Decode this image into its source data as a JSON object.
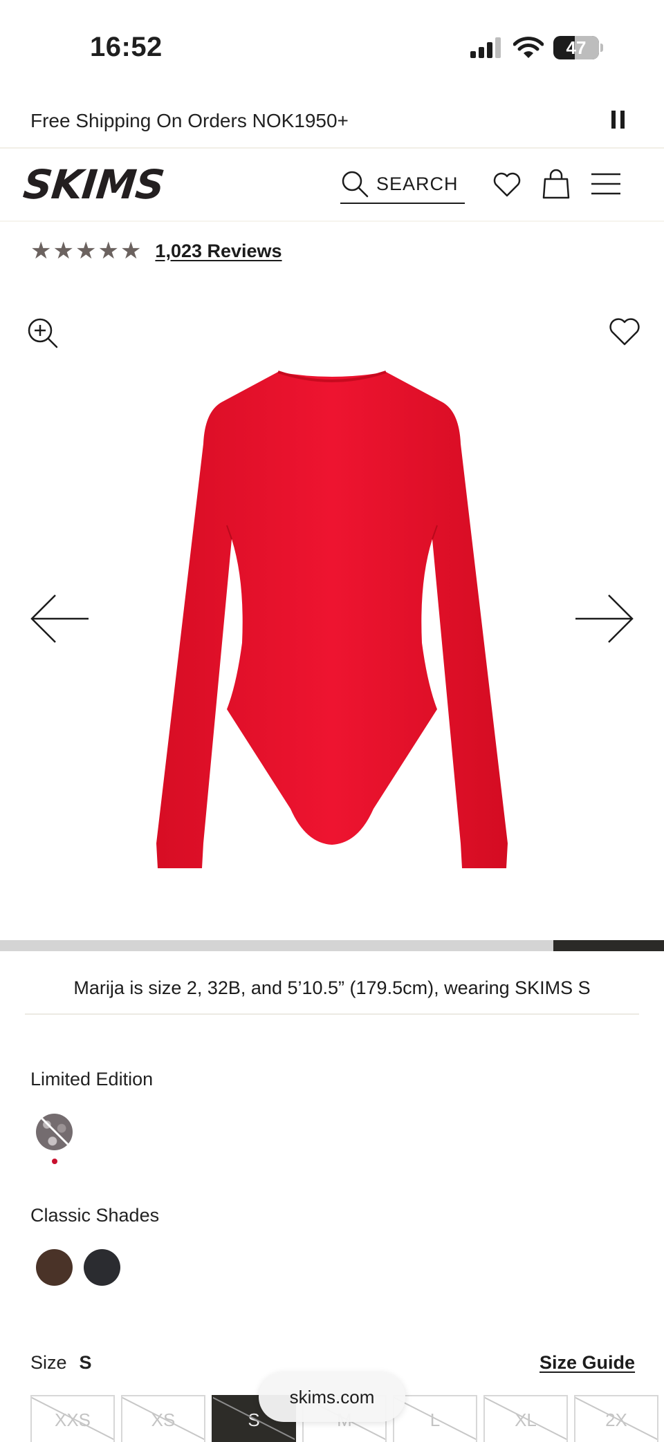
{
  "status": {
    "time": "16:52",
    "battery": "47",
    "battery_level": 0.47,
    "icons": [
      "signal-icon",
      "wifi-icon",
      "battery-icon"
    ]
  },
  "promo": {
    "text": "Free Shipping On Orders NOK1950+",
    "control_icon": "pause-icon"
  },
  "header": {
    "logo_text": "SKIMS",
    "search_label": "SEARCH",
    "icons": [
      "search-icon",
      "heart-icon",
      "bag-icon",
      "menu-icon"
    ]
  },
  "rating": {
    "stars": 5,
    "reviews_label": "1,023 Reviews",
    "star_color": "#6b625f"
  },
  "gallery": {
    "product_color": "#e8102a",
    "progress_start": 0.833,
    "progress_end": 1.0,
    "icons": [
      "zoom-in-icon",
      "heart-icon",
      "arrow-left-icon",
      "arrow-right-icon"
    ]
  },
  "model_note": "Marija is size 2, 32B, and 5’10.5” (179.5cm), wearing SKIMS S",
  "colors": {
    "limited_label": "Limited Edition",
    "classic_label": "Classic Shades",
    "limited_swatches": [
      "snake print"
    ],
    "classic_swatches": [
      "#4a3328",
      "#2b2c30"
    ],
    "selected_indicator_color": "#c8102e"
  },
  "size": {
    "label": "Size",
    "current": "S",
    "guide_label": "Size Guide",
    "options": [
      {
        "label": "XXS",
        "selected": false
      },
      {
        "label": "XS",
        "selected": false
      },
      {
        "label": "S",
        "selected": true
      },
      {
        "label": "M",
        "selected": false
      },
      {
        "label": "L",
        "selected": false
      },
      {
        "label": "XL",
        "selected": false
      },
      {
        "label": "2X",
        "selected": false
      }
    ]
  },
  "browser": {
    "url": "skims.com"
  }
}
